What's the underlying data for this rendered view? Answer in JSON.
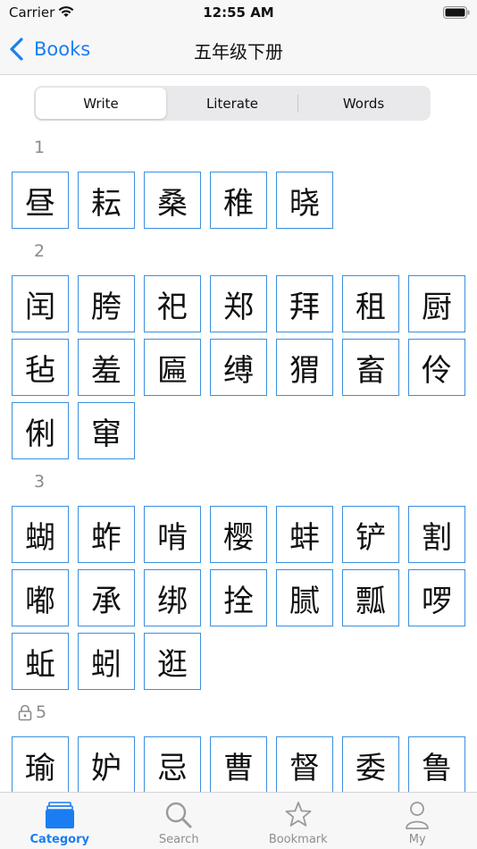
{
  "status": {
    "carrier": "Carrier",
    "time": "12:55 AM"
  },
  "nav": {
    "back_label": "Books",
    "title": "五年级下册"
  },
  "segments": [
    {
      "label": "Write",
      "active": true
    },
    {
      "label": "Literate",
      "active": false
    },
    {
      "label": "Words",
      "active": false
    }
  ],
  "sections": [
    {
      "label": "1",
      "locked": false,
      "chars": [
        "昼",
        "耘",
        "桑",
        "稚",
        "晓"
      ]
    },
    {
      "label": "2",
      "locked": false,
      "chars": [
        "闰",
        "胯",
        "祀",
        "郑",
        "拜",
        "租",
        "厨",
        "毡",
        "羞",
        "匾",
        "缚",
        "猬",
        "畜",
        "伶",
        "俐",
        "窜"
      ]
    },
    {
      "label": "3",
      "locked": false,
      "chars": [
        "蝴",
        "蚱",
        "啃",
        "樱",
        "蚌",
        "铲",
        "割",
        "嘟",
        "承",
        "绑",
        "拴",
        "腻",
        "瓢",
        "啰",
        "蚯",
        "蚓",
        "逛"
      ]
    },
    {
      "label": "5",
      "locked": true,
      "chars": [
        "瑜",
        "妒",
        "忌",
        "曹",
        "督",
        "委",
        "鲁"
      ]
    }
  ],
  "tabs": [
    {
      "label": "Category",
      "icon": "category-icon",
      "active": true
    },
    {
      "label": "Search",
      "icon": "search-icon",
      "active": false
    },
    {
      "label": "Bookmark",
      "icon": "star-icon",
      "active": false
    },
    {
      "label": "My",
      "icon": "person-icon",
      "active": false
    }
  ],
  "colors": {
    "accent": "#1a7ef2",
    "cell_border": "#3b8fe0",
    "section_label": "#8a8a8e"
  }
}
